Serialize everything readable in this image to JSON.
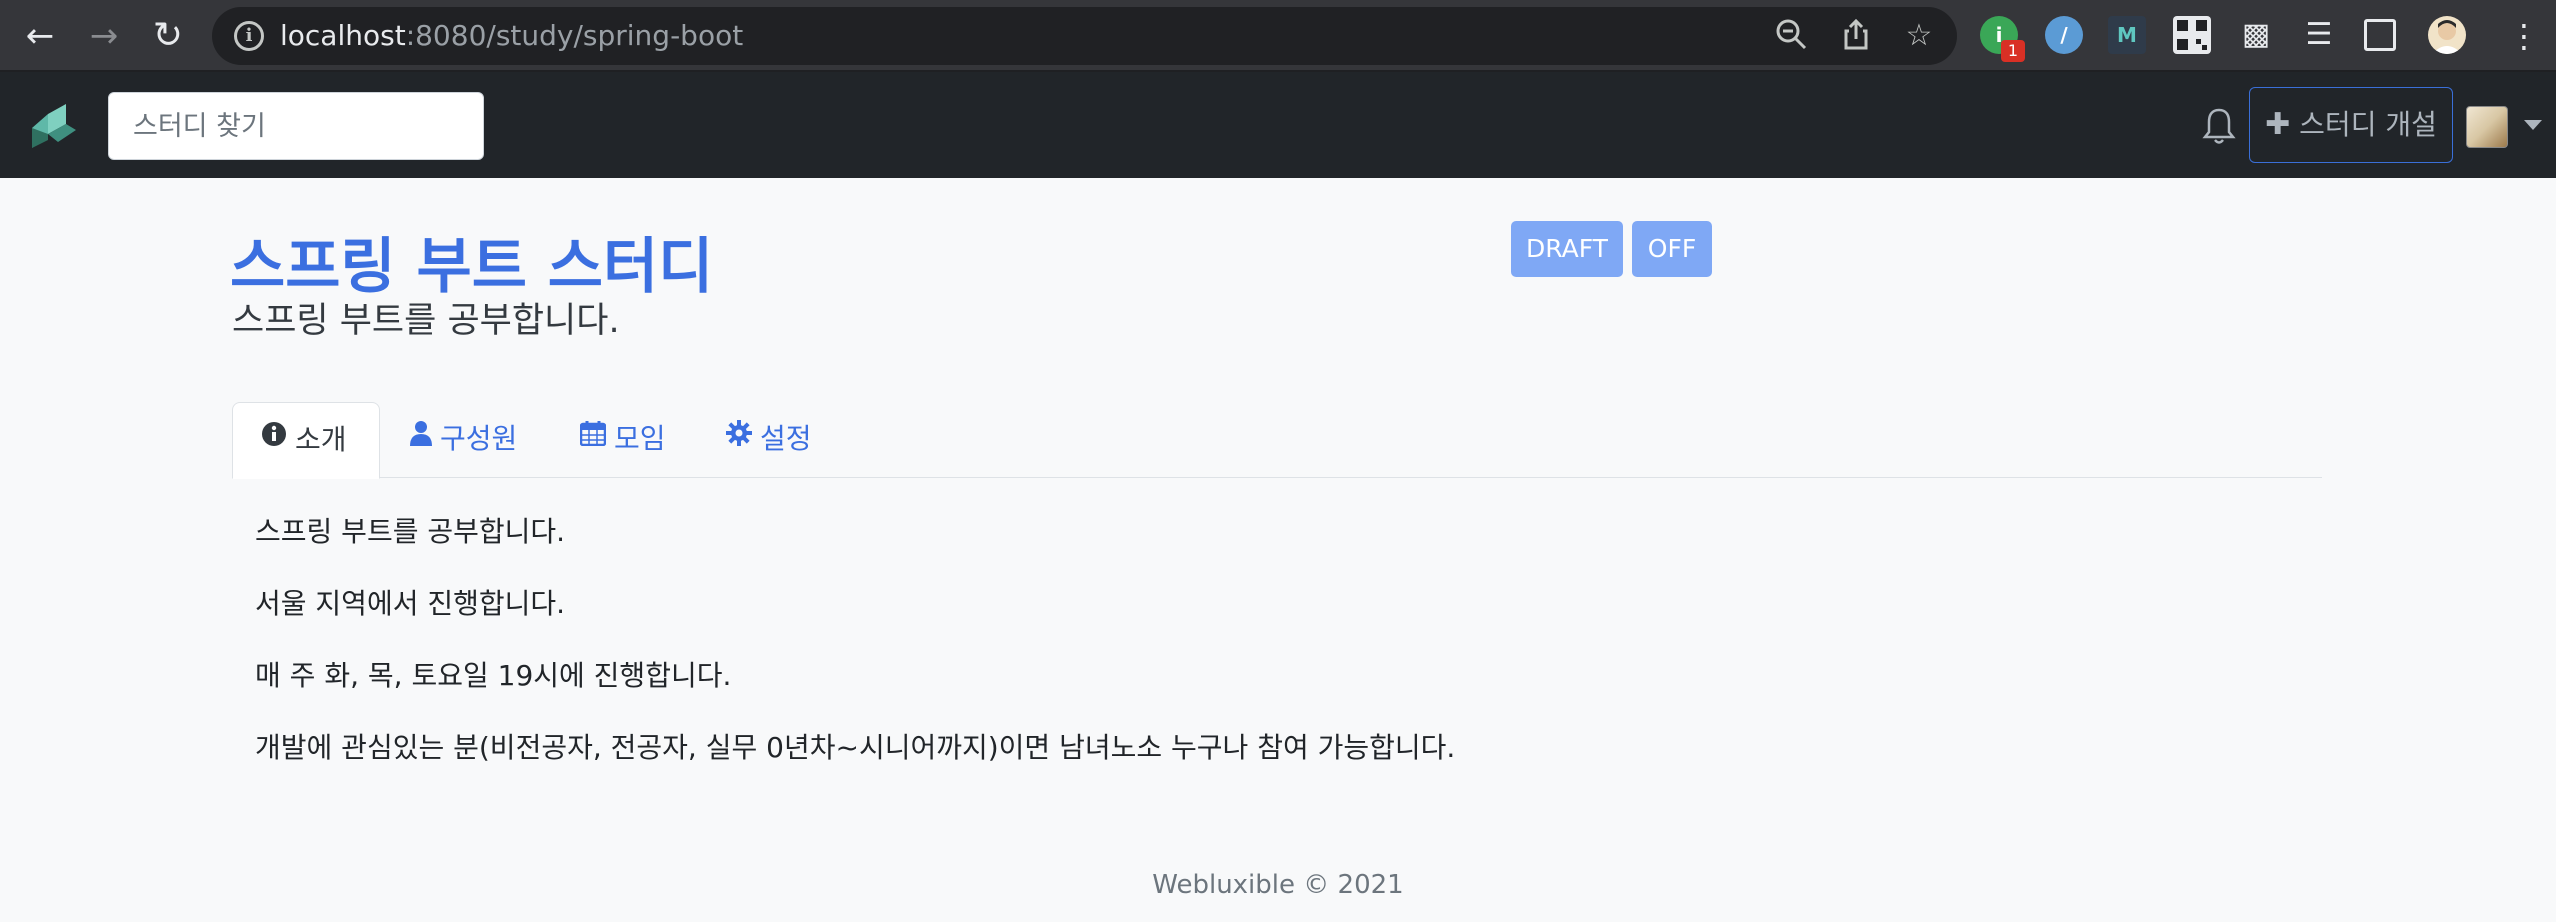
{
  "browser": {
    "url_host": "localhost",
    "url_path": ":8080/study/spring-boot",
    "extension_badge": "1"
  },
  "navbar": {
    "search_placeholder": "스터디 찾기",
    "open_study_label": "스터디 개설"
  },
  "study": {
    "title": "스프링 부트 스터디",
    "short_description": "스프링 부트를 공부합니다.",
    "badges": [
      "DRAFT",
      "OFF"
    ]
  },
  "tabs": [
    {
      "label": "소개",
      "icon": "info-circle-icon",
      "active": true
    },
    {
      "label": "구성원",
      "icon": "user-icon",
      "active": false
    },
    {
      "label": "모임",
      "icon": "calendar-icon",
      "active": false
    },
    {
      "label": "설정",
      "icon": "gear-icon",
      "active": false
    }
  ],
  "description": [
    "스프링 부트를 공부합니다.",
    "서울 지역에서 진행합니다.",
    "매 주 화, 목, 토요일 19시에 진행합니다.",
    "개발에 관심있는 분(비전공자, 전공자, 실무 0년차~시니어까지)이면 남녀노소 누구나 참여 가능합니다."
  ],
  "footer": "Webluxible © 2021",
  "colors": {
    "primary": "#3b6fe0",
    "badge": "#7fa8f5",
    "navbar": "#212529",
    "chrome": "#35363a"
  }
}
